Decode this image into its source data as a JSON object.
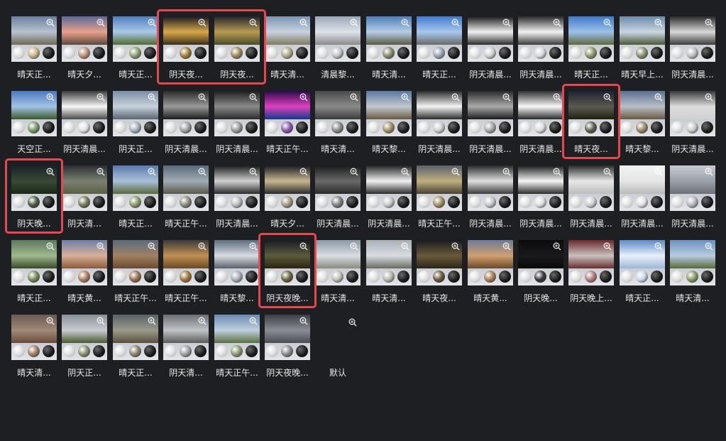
{
  "tiles": [
    {
      "row": 0,
      "col": 0,
      "label": "晴天正...",
      "sky": [
        "#6a7fa0",
        "#b8c3cf",
        "#6f6a55"
      ],
      "ball": "#c7b48a"
    },
    {
      "row": 0,
      "col": 1,
      "label": "晴天夕...",
      "sky": [
        "#5a6a98",
        "#e9a08c",
        "#5a4a3a"
      ],
      "ball": "#b89078"
    },
    {
      "row": 0,
      "col": 2,
      "label": "晴天正...",
      "sky": [
        "#4f7fc0",
        "#a9c8e8",
        "#4f6e2e"
      ],
      "ball": "#8ea070"
    },
    {
      "row": 0,
      "col": 3,
      "label": "阴天夜...",
      "sky": [
        "#1a1a22",
        "#d8a84a",
        "#3a2e18"
      ],
      "ball": "#a0803a"
    },
    {
      "row": 0,
      "col": 4,
      "label": "阴天夜...",
      "sky": [
        "#23252c",
        "#b89a52",
        "#4a4a2a"
      ],
      "ball": "#9a8a5a"
    },
    {
      "row": 0,
      "col": 5,
      "label": "晴天清...",
      "sky": [
        "#7c95b4",
        "#c7d2dd",
        "#7f7a60"
      ],
      "ball": "#b0a888"
    },
    {
      "row": 0,
      "col": 6,
      "label": "清晨黎...",
      "sky": [
        "#9aa8b8",
        "#dde2e8",
        "#8a8a8a"
      ],
      "ball": "#c0c4c8"
    },
    {
      "row": 0,
      "col": 7,
      "label": "晴天清...",
      "sky": [
        "#4f7eb8",
        "#b5cde6",
        "#5a5a40"
      ],
      "ball": "#8a8a6a"
    },
    {
      "row": 0,
      "col": 8,
      "label": "晴天正...",
      "sky": [
        "#3f7ad0",
        "#a8c8ec",
        "#6a6a6a"
      ],
      "ball": "#9aa6b4"
    },
    {
      "row": 0,
      "col": 9,
      "label": "阴天清晨...",
      "sky": [
        "#1a1a1a",
        "#f0f0f0",
        "#2a2a2a"
      ],
      "ball": "#d0d0d0"
    },
    {
      "row": 0,
      "col": 10,
      "label": "阴天清晨...",
      "sky": [
        "#2a2a2a",
        "#f2f2f2",
        "#3a3a3a"
      ],
      "ball": "#d8d8d8"
    },
    {
      "row": 0,
      "col": 11,
      "label": "晴天正...",
      "sky": [
        "#3f7ac8",
        "#9cc2ea",
        "#5c6a3a"
      ],
      "ball": "#8c9a6a"
    },
    {
      "row": 0,
      "col": 12,
      "label": "晴天早上...",
      "sky": [
        "#6a8aa8",
        "#c9d6e2",
        "#4a5a38"
      ],
      "ball": "#8a9070"
    },
    {
      "row": 0,
      "col": 13,
      "label": "阴天清晨...",
      "sky": [
        "#2a2a2a",
        "#d8d8d8",
        "#3a3a3a"
      ],
      "ball": "#c0c0c0"
    },
    {
      "row": 1,
      "col": 0,
      "label": "天空正...",
      "sky": [
        "#4a78c0",
        "#a4c4e8",
        "#3a5a2a"
      ],
      "ball": "#7c9a6a"
    },
    {
      "row": 1,
      "col": 1,
      "label": "阴天清晨...",
      "sky": [
        "#3a3a3a",
        "#f6f6f6",
        "#4a4a4a"
      ],
      "ball": "#e0e0e0"
    },
    {
      "row": 1,
      "col": 2,
      "label": "阴天正...",
      "sky": [
        "#7a8ea8",
        "#c8d2dc",
        "#5a6472"
      ],
      "ball": "#a8b0bc"
    },
    {
      "row": 1,
      "col": 3,
      "label": "阴天清晨...",
      "sky": [
        "#2a2a2a",
        "#9a9a9a",
        "#1a1a1a"
      ],
      "ball": "#a0a0a0"
    },
    {
      "row": 1,
      "col": 4,
      "label": "阴天清晨...",
      "sky": [
        "#1e1e1e",
        "#8a8a8a",
        "#2a2a2a"
      ],
      "ball": "#9a9a9a"
    },
    {
      "row": 1,
      "col": 5,
      "label": "晴天正午...",
      "sky": [
        "#2a0a4a",
        "#e040c0",
        "#103a8a"
      ],
      "ball": "#8a5aa8"
    },
    {
      "row": 1,
      "col": 6,
      "label": "晴天清...",
      "sky": [
        "#4a4a4a",
        "#8a8a8a",
        "#3a3a3a"
      ],
      "ball": "#8a8a8a"
    },
    {
      "row": 1,
      "col": 7,
      "label": "晴天黎...",
      "sky": [
        "#5a78a0",
        "#c0c8d0",
        "#6a5a40"
      ],
      "ball": "#a0906a"
    },
    {
      "row": 1,
      "col": 8,
      "label": "阴天清晨...",
      "sky": [
        "#2a2a2a",
        "#f4f4f4",
        "#2a2a2a"
      ],
      "ball": "#d0d0d0"
    },
    {
      "row": 1,
      "col": 9,
      "label": "阴天清晨...",
      "sky": [
        "#2a2a2a",
        "#aaaaaa",
        "#1a1a1a"
      ],
      "ball": "#a8a8a8"
    },
    {
      "row": 1,
      "col": 10,
      "label": "阴天清晨...",
      "sky": [
        "#303030",
        "#f8f8f8",
        "#2a2a2a"
      ],
      "ball": "#dadada"
    },
    {
      "row": 1,
      "col": 11,
      "label": "晴天夜...",
      "sky": [
        "#1e2230",
        "#5a5a50",
        "#202010"
      ],
      "ball": "#606050"
    },
    {
      "row": 1,
      "col": 12,
      "label": "晴天黎...",
      "sky": [
        "#5a7090",
        "#b8c0c8",
        "#6a5a40"
      ],
      "ball": "#9a8a6a"
    },
    {
      "row": 1,
      "col": 13,
      "label": "阴天清晨...",
      "sky": [
        "#3a3a3a",
        "#dcdcdc",
        "#d0d0d0"
      ],
      "ball": "#cacaca"
    },
    {
      "row": 2,
      "col": 0,
      "label": "阴天晚...",
      "sky": [
        "#1a2028",
        "#3a4838",
        "#1a2818"
      ],
      "ball": "#4a5a40"
    },
    {
      "row": 2,
      "col": 1,
      "label": "阴天清...",
      "sky": [
        "#2a2e34",
        "#7a8070",
        "#5a6040"
      ],
      "ball": "#7a7a5a"
    },
    {
      "row": 2,
      "col": 2,
      "label": "晴天正...",
      "sky": [
        "#5a7ab0",
        "#a8c0d8",
        "#5a6a3a"
      ],
      "ball": "#8a9a6a"
    },
    {
      "row": 2,
      "col": 3,
      "label": "晴天正午...",
      "sky": [
        "#5a6a7a",
        "#a0aab4",
        "#5a5a4a"
      ],
      "ball": "#8a8a7a"
    },
    {
      "row": 2,
      "col": 4,
      "label": "阴天清晨...",
      "sky": [
        "#1a1a1a",
        "#d0d0d0",
        "#2a2a2a"
      ],
      "ball": "#bcbcbc"
    },
    {
      "row": 2,
      "col": 5,
      "label": "晴天夕...",
      "sky": [
        "#1a1a20",
        "#c8b890",
        "#2a2a2a"
      ],
      "ball": "#a09880"
    },
    {
      "row": 2,
      "col": 6,
      "label": "阴天清晨...",
      "sky": [
        "#1a1a1a",
        "#6a6a6a",
        "#2a2a2a"
      ],
      "ball": "#808080"
    },
    {
      "row": 2,
      "col": 7,
      "label": "阴天清晨...",
      "sky": [
        "#222222",
        "#f0f0f0",
        "#2a2a2a"
      ],
      "ball": "#c8c8c8"
    },
    {
      "row": 2,
      "col": 8,
      "label": "晴天正午...",
      "sky": [
        "#5a6068",
        "#c0b080",
        "#4a4030"
      ],
      "ball": "#a09060"
    },
    {
      "row": 2,
      "col": 9,
      "label": "阴天清晨...",
      "sky": [
        "#2a2a2a",
        "#e0e0e0",
        "#3a3a3a"
      ],
      "ball": "#c8c8c8"
    },
    {
      "row": 2,
      "col": 10,
      "label": "阴天清晨...",
      "sky": [
        "#1a1a1a",
        "#f6f6f6",
        "#2a2a2a"
      ],
      "ball": "#dedede"
    },
    {
      "row": 2,
      "col": 11,
      "label": "阴天清晨...",
      "sky": [
        "#2a2a2a",
        "#e8e8e8",
        "#bcbcbc"
      ],
      "ball": "#d0d0d0"
    },
    {
      "row": 2,
      "col": 12,
      "label": "阴天清晨...",
      "sky": [
        "#f2f2f2",
        "#e6e6e6",
        "#bababa"
      ],
      "ball": "#e0e0e0"
    },
    {
      "row": 2,
      "col": 13,
      "label": "阴天清晨...",
      "sky": [
        "#c8ccd2",
        "#9aa0a8",
        "#6a7078"
      ],
      "ball": "#b4b8be"
    },
    {
      "row": 3,
      "col": 0,
      "label": "晴天正...",
      "sky": [
        "#5a7a5a",
        "#a0b890",
        "#3a4a2a"
      ],
      "ball": "#7a8a5a"
    },
    {
      "row": 3,
      "col": 1,
      "label": "晴天黄...",
      "sky": [
        "#6a80a8",
        "#d8b098",
        "#8a5a3a"
      ],
      "ball": "#b08060"
    },
    {
      "row": 3,
      "col": 2,
      "label": "晴天正午...",
      "sky": [
        "#5a6a80",
        "#a08060",
        "#6a4a30"
      ],
      "ball": "#9a7050"
    },
    {
      "row": 3,
      "col": 3,
      "label": "晴天正午...",
      "sky": [
        "#3a3a3a",
        "#c09050",
        "#6a4a28"
      ],
      "ball": "#a07840"
    },
    {
      "row": 3,
      "col": 4,
      "label": "晴天黎...",
      "sky": [
        "#5a6a80",
        "#d8dce2",
        "#5a6068"
      ],
      "ball": "#a8b0b8"
    },
    {
      "row": 3,
      "col": 5,
      "label": "阴天夜晚...",
      "sky": [
        "#1a1c22",
        "#5a5a3a",
        "#2a2410"
      ],
      "ball": "#6a6440"
    },
    {
      "row": 3,
      "col": 6,
      "label": "晴天清...",
      "sky": [
        "#8a98a8",
        "#dadee2",
        "#8a8a80"
      ],
      "ball": "#c0c0b8"
    },
    {
      "row": 3,
      "col": 7,
      "label": "晴天清...",
      "sky": [
        "#a8b0b8",
        "#d8dce0",
        "#6a6a60"
      ],
      "ball": "#b8b8b0"
    },
    {
      "row": 3,
      "col": 8,
      "label": "晴天夜...",
      "sky": [
        "#1a1c20",
        "#6a5a3a",
        "#2a2418"
      ],
      "ball": "#6a5a40"
    },
    {
      "row": 3,
      "col": 9,
      "label": "晴天黄...",
      "sky": [
        "#6a7a98",
        "#d0a070",
        "#6a4a2a"
      ],
      "ball": "#a8805a"
    },
    {
      "row": 3,
      "col": 10,
      "label": "阴天晚...",
      "sky": [
        "#0a0a0c",
        "#1a1a1c",
        "#0a0a0a"
      ],
      "ball": "#3a3a3a"
    },
    {
      "row": 3,
      "col": 11,
      "label": "阴天晚上...",
      "sky": [
        "#6a2a2a",
        "#c8c0c0",
        "#6a3030"
      ],
      "ball": "#b08080"
    },
    {
      "row": 3,
      "col": 12,
      "label": "晴天正...",
      "sky": [
        "#5a8ac8",
        "#e8f0f8",
        "#9ab8d8"
      ],
      "ball": "#c8d8e8"
    },
    {
      "row": 3,
      "col": 13,
      "label": "晴天清...",
      "sky": [
        "#6a90c0",
        "#b8cce0",
        "#5a6a3a"
      ],
      "ball": "#8a9a6a"
    },
    {
      "row": 4,
      "col": 0,
      "label": "晴天清...",
      "sky": [
        "#6a5a50",
        "#a08a78",
        "#6a4a38"
      ],
      "ball": "#a08068"
    },
    {
      "row": 4,
      "col": 1,
      "label": "阴天正...",
      "sky": [
        "#8a9098",
        "#c8ccd0",
        "#4a5a30"
      ],
      "ball": "#8a9070"
    },
    {
      "row": 4,
      "col": 2,
      "label": "晴天正...",
      "sky": [
        "#5a6068",
        "#9a9a8a",
        "#5a5040"
      ],
      "ball": "#8a8470"
    },
    {
      "row": 4,
      "col": 3,
      "label": "阴天清...",
      "sky": [
        "#6a6e74",
        "#c0c4c8",
        "#5a5a58"
      ],
      "ball": "#a0a0a0"
    },
    {
      "row": 4,
      "col": 4,
      "label": "晴天正午...",
      "sky": [
        "#6a8ab0",
        "#c0d0e0",
        "#5a7040"
      ],
      "ball": "#8a9a70"
    },
    {
      "row": 4,
      "col": 5,
      "label": "阴天夜晚...",
      "sky": [
        "#3a3e44",
        "#8a8e94",
        "#4a4e54"
      ],
      "ball": "#8a8a8a"
    }
  ],
  "default_label": "默认",
  "icons": {
    "zoom": "zoom-in-icon"
  },
  "colors": {
    "background": "#1e1f22",
    "highlight": "#e5484d",
    "label": "#e8e8e8"
  },
  "highlights": [
    {
      "name": "highlight-group-row0",
      "tiles": [
        "0-3",
        "0-4"
      ]
    },
    {
      "name": "highlight-row1-col11",
      "tiles": [
        "1-11"
      ]
    },
    {
      "name": "highlight-row2-col0",
      "tiles": [
        "2-0"
      ]
    },
    {
      "name": "highlight-row3-col5",
      "tiles": [
        "3-5"
      ]
    }
  ]
}
